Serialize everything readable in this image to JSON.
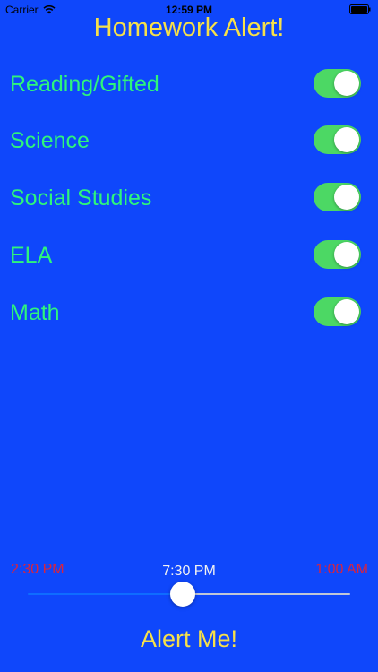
{
  "status_bar": {
    "carrier": "Carrier",
    "time": "12:59 PM",
    "wifi_icon": "wifi-icon",
    "battery_icon": "battery-icon"
  },
  "title": "Homework Alert!",
  "subjects": [
    {
      "label": "Reading/Gifted",
      "enabled": true
    },
    {
      "label": "Science",
      "enabled": true
    },
    {
      "label": "Social Studies",
      "enabled": true
    },
    {
      "label": "ELA",
      "enabled": true
    },
    {
      "label": "Math",
      "enabled": true
    }
  ],
  "time_slider": {
    "min_label": "2:30 PM",
    "max_label": "1:00 AM",
    "current_label": "7:30 PM",
    "position_fraction": 0.48
  },
  "alert_button_label": "Alert Me!",
  "colors": {
    "background": "#0f47fb",
    "title": "#f6e04a",
    "subject_text": "#2ef57b",
    "toggle_on": "#4cd864",
    "range_labels": "#d9243f",
    "slider_min_track": "#0f6cff"
  }
}
